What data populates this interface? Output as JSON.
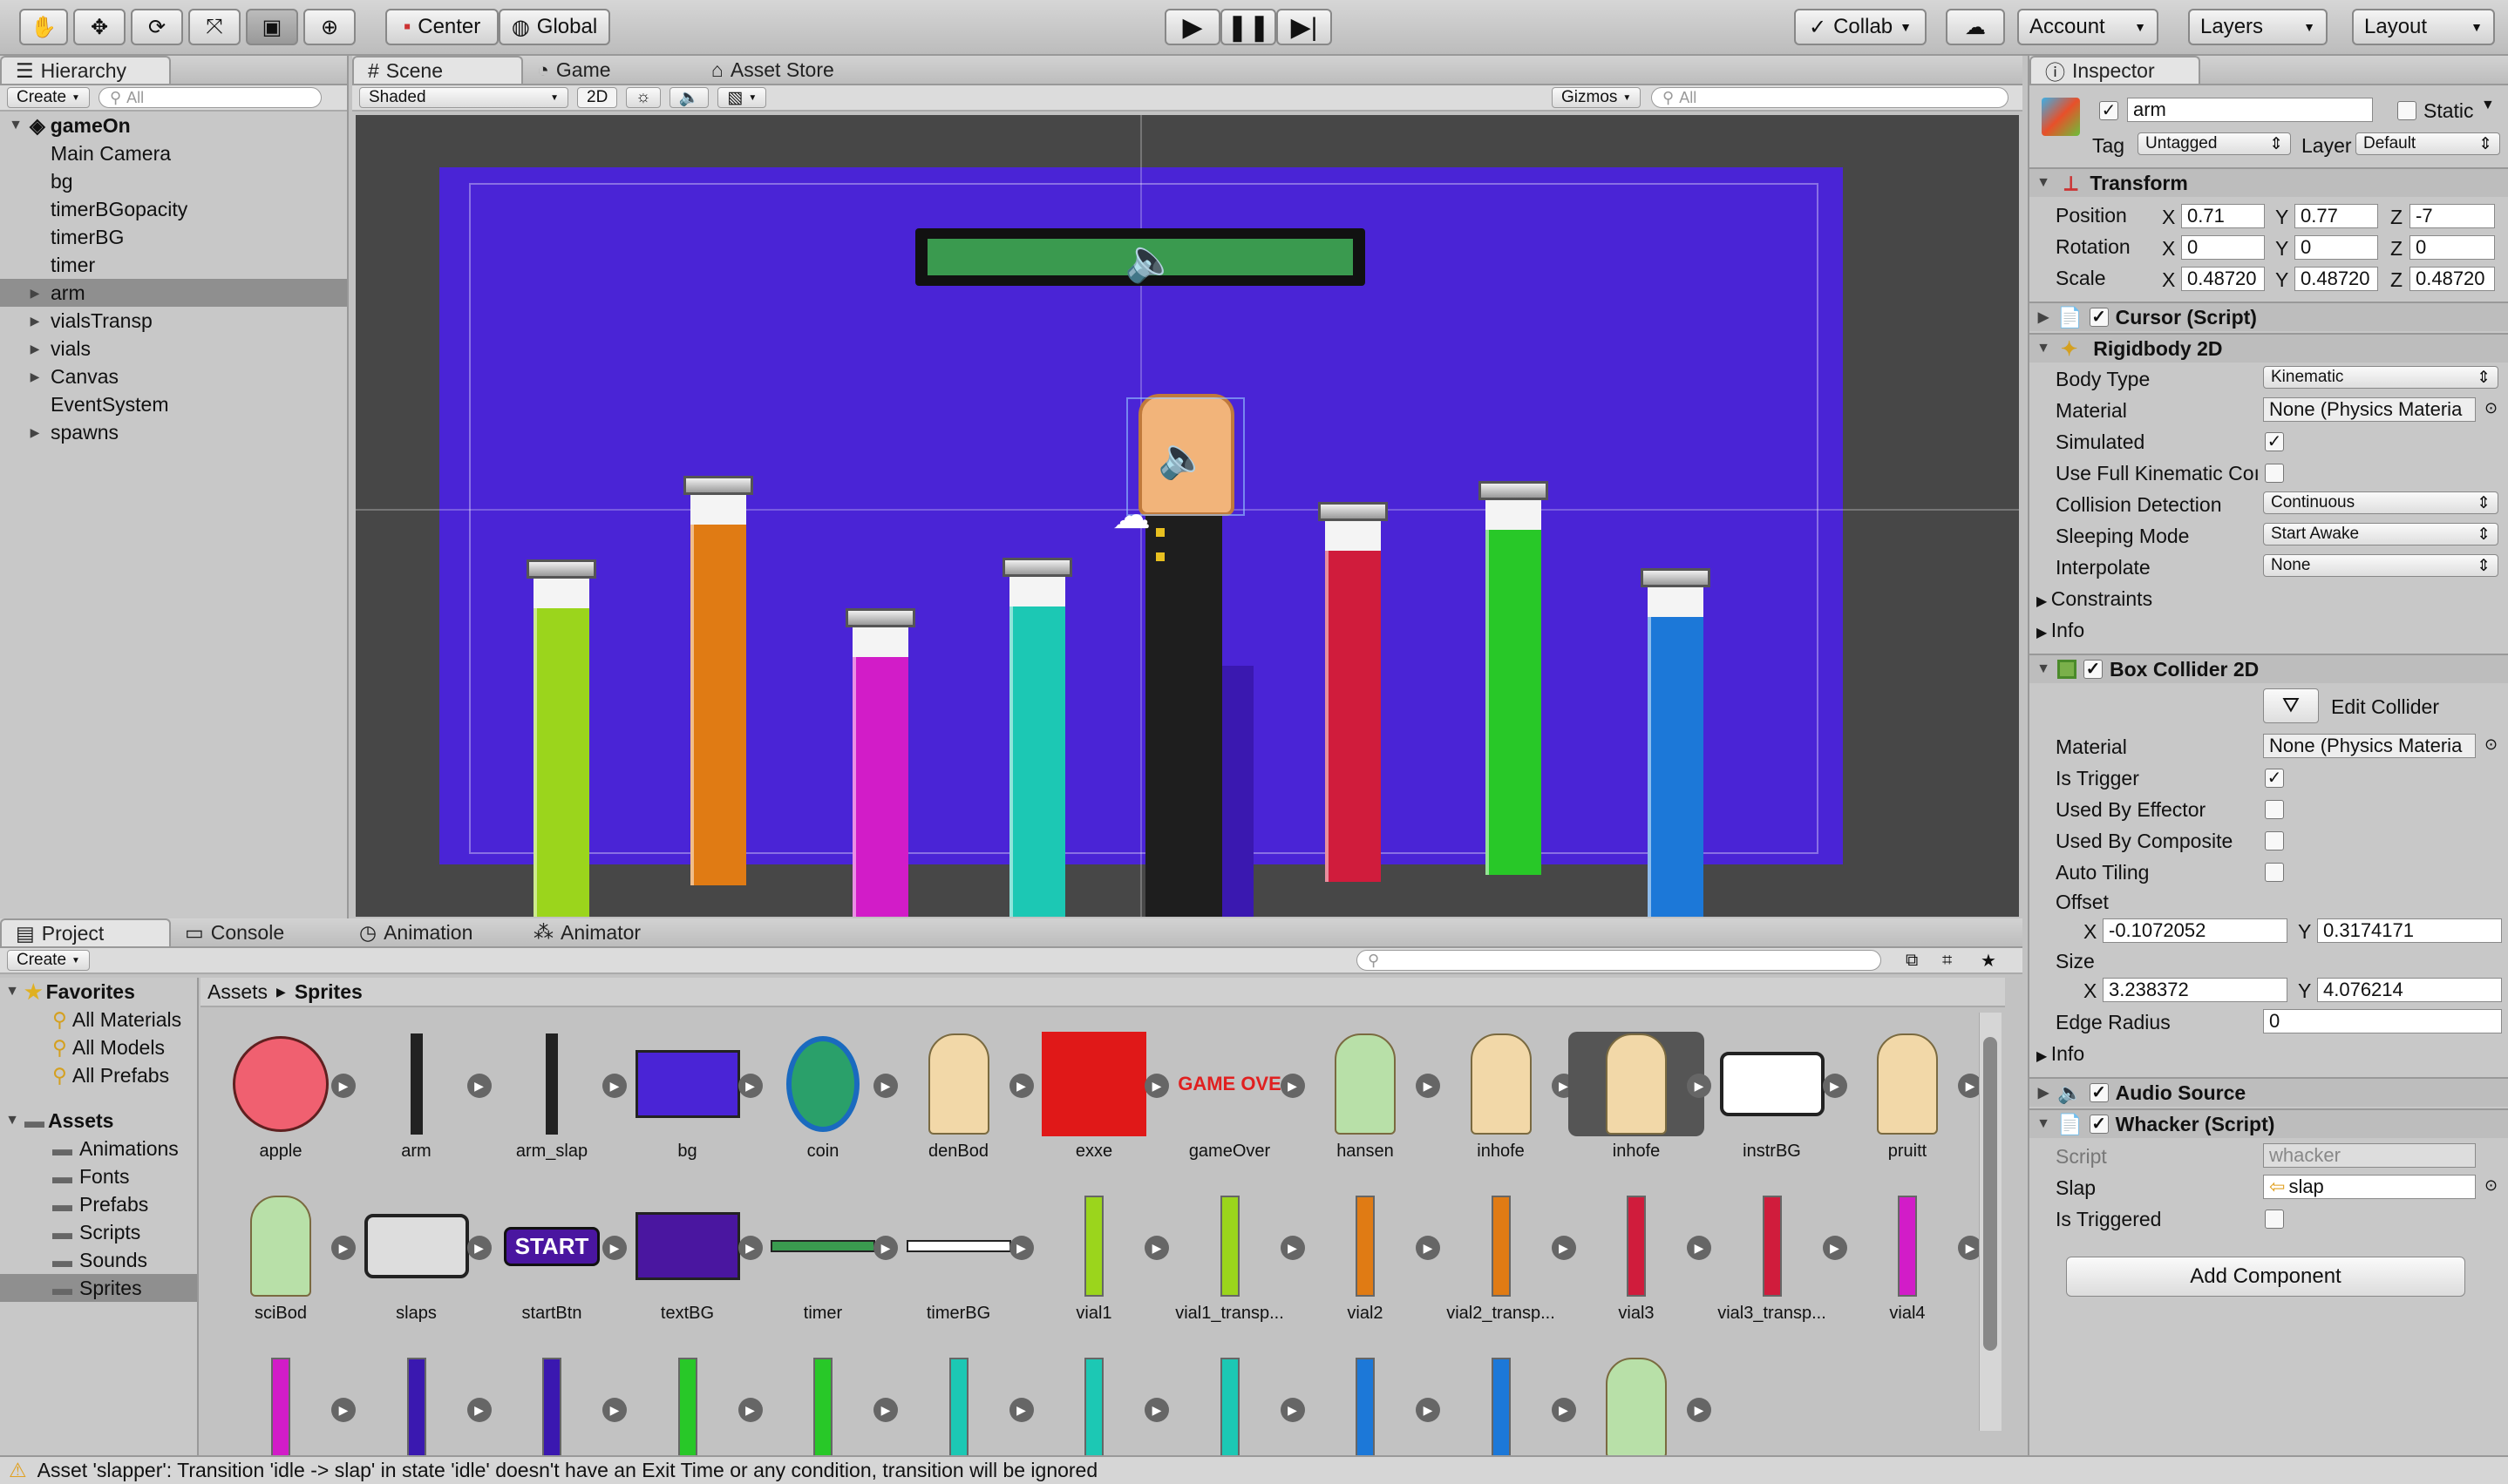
{
  "toolbar": {
    "tools": [
      "hand-tool",
      "move-tool",
      "rotate-tool",
      "scale-tool",
      "rect-tool",
      "transform-tool"
    ],
    "pivot": "Center",
    "space": "Global",
    "collab": "Collab",
    "account": "Account",
    "layers": "Layers",
    "layout": "Layout"
  },
  "hierarchy": {
    "tab": "Hierarchy",
    "create": "Create",
    "search_placeholder": "All",
    "scene_name": "gameOn",
    "items": [
      {
        "label": "Main Camera",
        "expandable": false
      },
      {
        "label": "bg",
        "expandable": false
      },
      {
        "label": "timerBGopacity",
        "expandable": false
      },
      {
        "label": "timerBG",
        "expandable": false
      },
      {
        "label": "timer",
        "expandable": false
      },
      {
        "label": "arm",
        "expandable": true,
        "selected": true
      },
      {
        "label": "vialsTransp",
        "expandable": true
      },
      {
        "label": "vials",
        "expandable": true
      },
      {
        "label": "Canvas",
        "expandable": true
      },
      {
        "label": "EventSystem",
        "expandable": false
      },
      {
        "label": "spawns",
        "expandable": true
      }
    ]
  },
  "scene": {
    "tabs": [
      "Scene",
      "Game",
      "Asset Store"
    ],
    "shading": "Shaded",
    "mode_2d": "2D",
    "gizmos": "Gizmos",
    "search_placeholder": "All",
    "colors": {
      "bg": "#4a24d6",
      "timer_bar": "#3a9a4f"
    }
  },
  "inspector": {
    "tab": "Inspector",
    "object_name": "arm",
    "static": "Static",
    "tag_label": "Tag",
    "tag": "Untagged",
    "layer_label": "Layer",
    "layer": "Default",
    "transform": {
      "title": "Transform",
      "position_label": "Position",
      "position": [
        "0.71",
        "0.77",
        "-7"
      ],
      "rotation_label": "Rotation",
      "rotation": [
        "0",
        "0",
        "0"
      ],
      "scale_label": "Scale",
      "scale": [
        "0.48720",
        "0.48720",
        "0.48720"
      ]
    },
    "cursor_script": "Cursor (Script)",
    "rigidbody": {
      "title": "Rigidbody 2D",
      "body_type_label": "Body Type",
      "body_type": "Kinematic",
      "material_label": "Material",
      "material": "None (Physics Materia",
      "simulated_label": "Simulated",
      "full_kinematic_label": "Use Full Kinematic Coı",
      "collision_label": "Collision Detection",
      "collision": "Continuous",
      "sleeping_label": "Sleeping Mode",
      "sleeping": "Start Awake",
      "interpolate_label": "Interpolate",
      "interpolate": "None",
      "constraints_label": "Constraints",
      "info_label": "Info"
    },
    "box_collider": {
      "title": "Box Collider 2D",
      "edit_collider": "Edit Collider",
      "material_label": "Material",
      "material": "None (Physics Materia",
      "is_trigger_label": "Is Trigger",
      "used_by_effector_label": "Used By Effector",
      "used_by_composite_label": "Used By Composite",
      "auto_tiling_label": "Auto Tiling",
      "offset_label": "Offset",
      "offset": [
        "-0.1072052",
        "0.3174171"
      ],
      "size_label": "Size",
      "size": [
        "3.238372",
        "4.076214"
      ],
      "edge_radius_label": "Edge Radius",
      "edge_radius": "0",
      "info_label": "Info"
    },
    "audio_source": "Audio Source",
    "whacker": {
      "title": "Whacker (Script)",
      "script_label": "Script",
      "script": "whacker",
      "slap_label": "Slap",
      "slap": "slap",
      "is_triggered_label": "Is Triggered"
    },
    "add_component": "Add Component",
    "axis": [
      "X",
      "Y",
      "Z"
    ]
  },
  "project": {
    "tabs": [
      "Project",
      "Console",
      "Animation",
      "Animator"
    ],
    "create": "Create",
    "favorites": "Favorites",
    "favorite_items": [
      "All Materials",
      "All Models",
      "All Prefabs"
    ],
    "assets_root": "Assets",
    "folders": [
      "Animations",
      "Fonts",
      "Prefabs",
      "Scripts",
      "Sounds",
      "Sprites"
    ],
    "breadcrumb": [
      "Assets",
      "Sprites"
    ],
    "row1": [
      "apple",
      "arm",
      "arm_slap",
      "bg",
      "coin",
      "denBod",
      "exxe",
      "gameOver",
      "hansen",
      "inhofe",
      "inhofe",
      "instrBG",
      "pruitt"
    ],
    "row2": [
      "sciBod",
      "slaps",
      "startBtn",
      "textBG",
      "timer",
      "timerBG",
      "vial1",
      "vial1_transp...",
      "vial2",
      "vial2_transp...",
      "vial3",
      "vial3_transp...",
      "vial4"
    ],
    "game_over_text": "GAME OVE",
    "start_text": "START"
  },
  "status": {
    "message": "Asset 'slapper': Transition 'idle -> slap' in state 'idle' doesn't have an Exit Time or any condition, transition will be ignored"
  }
}
